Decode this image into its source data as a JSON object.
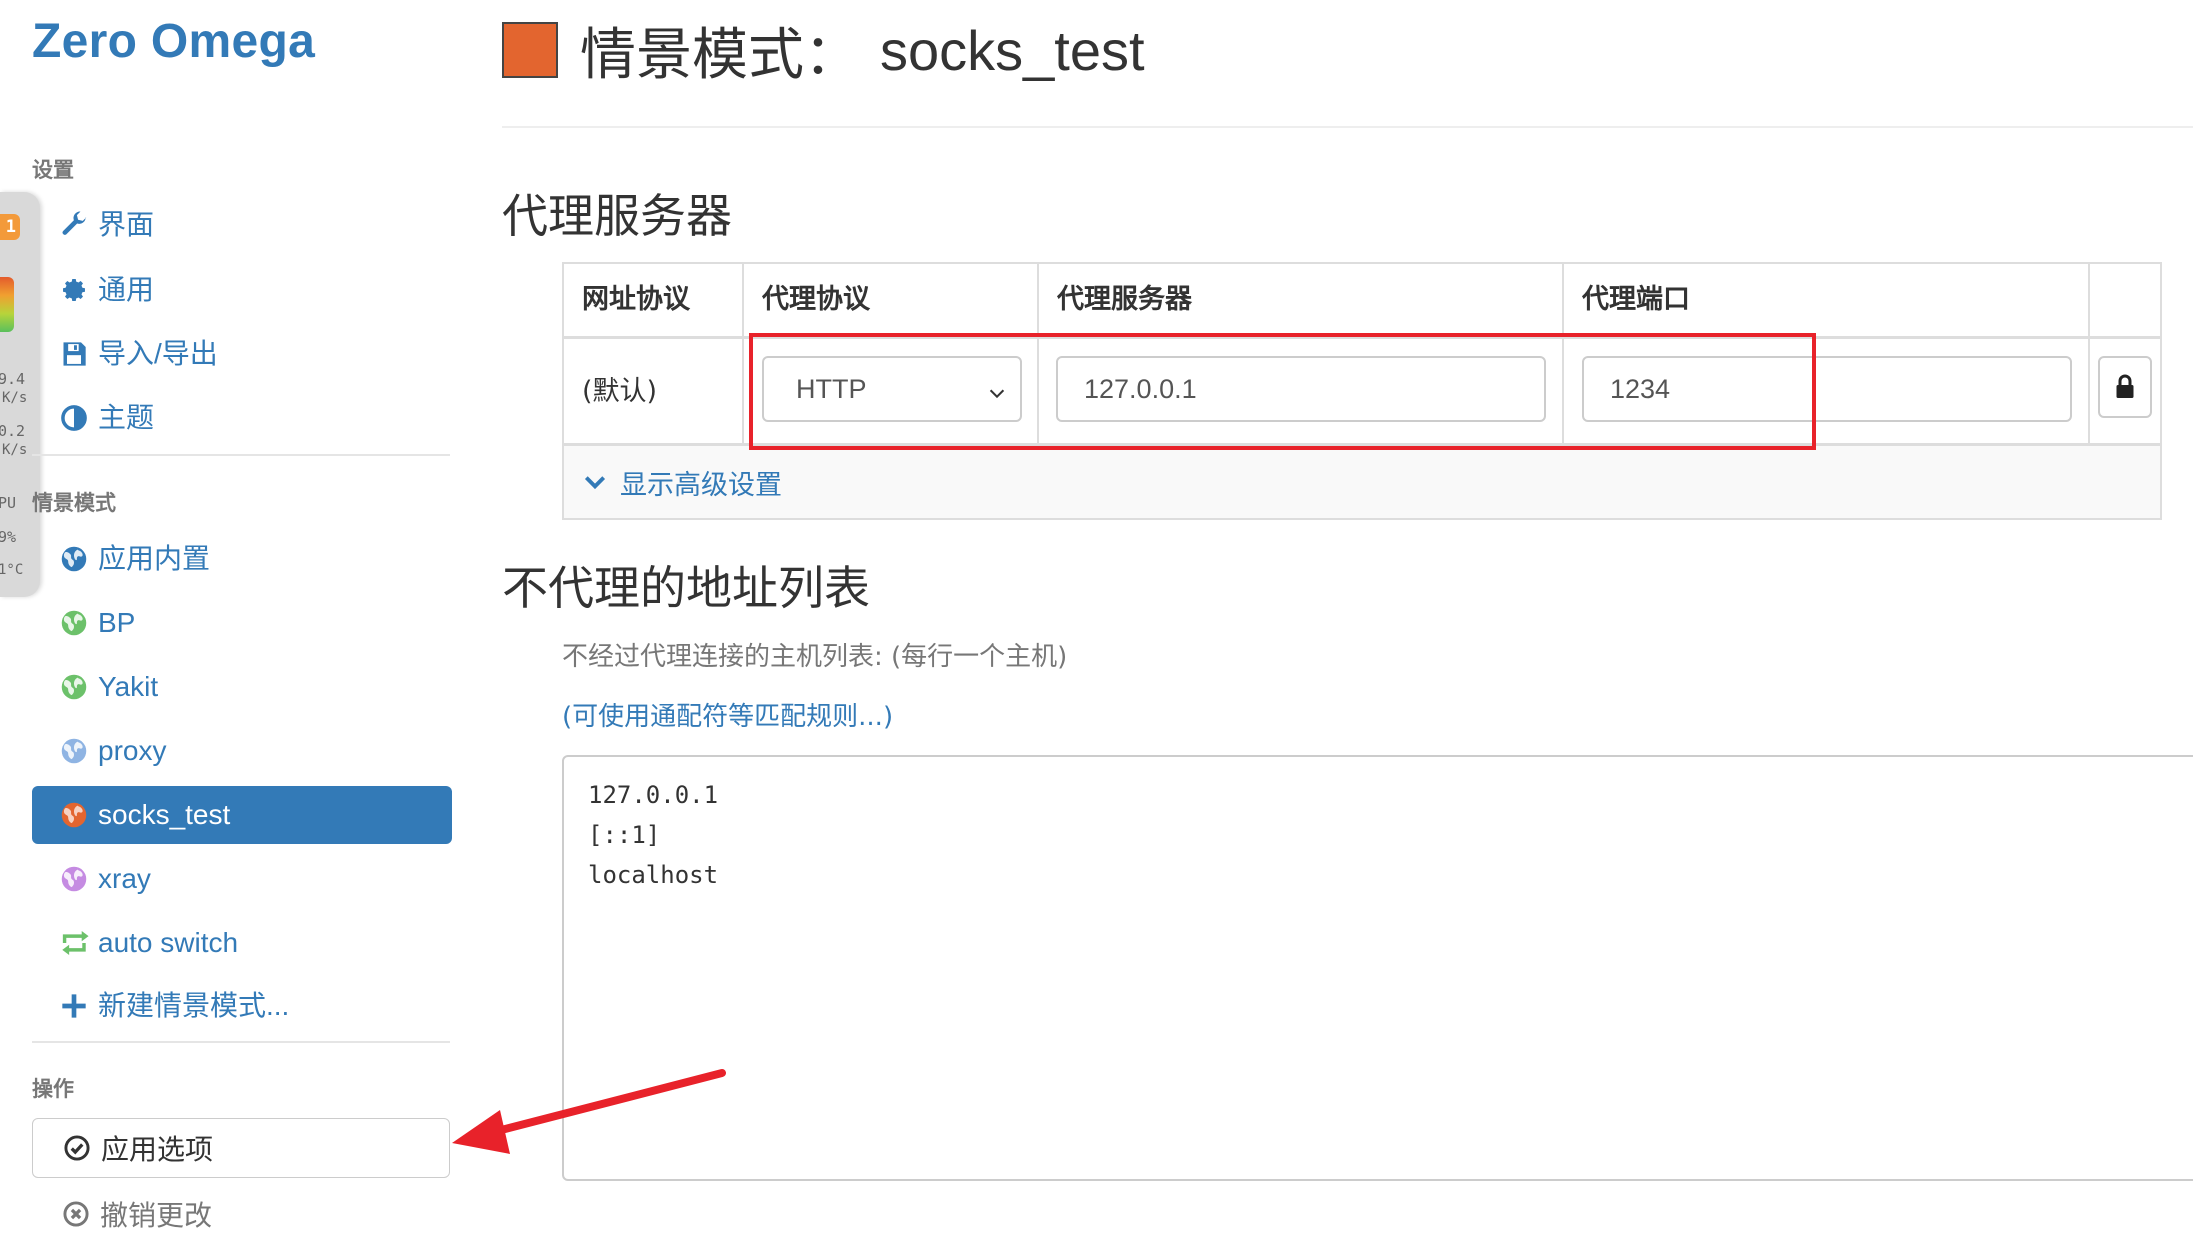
{
  "app": {
    "brand": "Zero Omega"
  },
  "sidebar": {
    "settings_header": "设置",
    "settings_items": [
      {
        "label": "界面",
        "icon": "wrench-icon"
      },
      {
        "label": "通用",
        "icon": "gear-icon"
      },
      {
        "label": "导入/导出",
        "icon": "floppy-disk-icon"
      },
      {
        "label": "主题",
        "icon": "contrast-icon"
      }
    ],
    "profiles_header": "情景模式",
    "profiles": [
      {
        "label": "应用内置",
        "icon": "globe-icon",
        "color": "#337ab7"
      },
      {
        "label": "BP",
        "icon": "globe-icon",
        "color": "#6cc16a"
      },
      {
        "label": "Yakit",
        "icon": "globe-icon",
        "color": "#6cc16a"
      },
      {
        "label": "proxy",
        "icon": "globe-icon",
        "color": "#8fb4e3"
      },
      {
        "label": "socks_test",
        "icon": "globe-icon",
        "color": "#e3652f",
        "active": true
      },
      {
        "label": "xray",
        "icon": "globe-icon",
        "color": "#c58be2"
      },
      {
        "label": "auto switch",
        "icon": "switch-icon",
        "color": "#6cc16a"
      },
      {
        "label": "新建情景模式...",
        "icon": "plus-icon",
        "color": "#337ab7"
      }
    ],
    "actions_header": "操作",
    "apply_label": "应用选项",
    "revert_label": "撤销更改"
  },
  "widget": {
    "badge": "1",
    "lines": [
      "9.4",
      "K/s",
      "0.2",
      "K/s",
      "PU",
      "9%",
      "1°C"
    ]
  },
  "main": {
    "title_prefix": "情景模式：",
    "profile_name": "socks_test",
    "profile_color": "#e3652f",
    "proxy_section_title": "代理服务器",
    "table": {
      "headers": [
        "网址协议",
        "代理协议",
        "代理服务器",
        "代理端口"
      ],
      "row_label": "(默认)",
      "protocol": "HTTP",
      "server": "127.0.0.1",
      "port": "1234"
    },
    "advanced_label": "显示高级设置",
    "bypass_section_title": "不代理的地址列表",
    "bypass_help": "不经过代理连接的主机列表: (每行一个主机)",
    "bypass_link": "(可使用通配符等匹配规则...)",
    "bypass_list": "127.0.0.1\n[::1]\nlocalhost"
  },
  "colors": {
    "accent": "#337ab7",
    "annotation_red": "#e8222a"
  }
}
